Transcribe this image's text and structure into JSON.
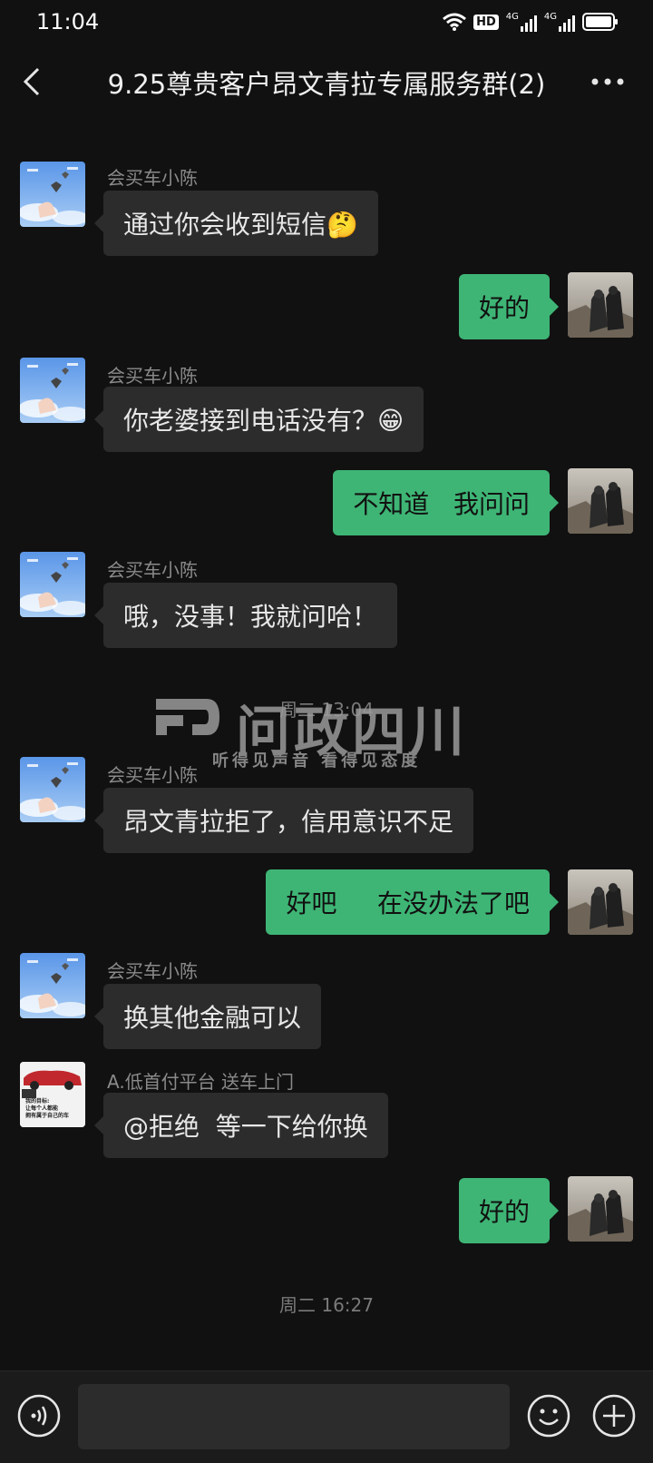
{
  "status_bar": {
    "time": "11:04",
    "icons": [
      "wifi-icon",
      "hd-icon",
      "signal-4g-icon",
      "signal-4g-icon",
      "battery-icon"
    ],
    "hd_label": "HD",
    "net_label_1": "4G",
    "net_label_2": "4G"
  },
  "nav": {
    "title": "9.25尊贵客户昂文青拉专属服务群(2)"
  },
  "messages": [
    {
      "side": "in",
      "sender": "会买车小陈",
      "text": "通过你会收到短信🤔"
    },
    {
      "side": "out",
      "text": "好的"
    },
    {
      "side": "in",
      "sender": "会买车小陈",
      "text": "你老婆接到电话没有？😁"
    },
    {
      "side": "out",
      "text": "不知道   我问问"
    },
    {
      "side": "in",
      "sender": "会买车小陈",
      "text": "哦，没事！我就问哈！"
    },
    {
      "side": "in",
      "sender": "会买车小陈",
      "text": "昂文青拉拒了，信用意识不足"
    },
    {
      "side": "out",
      "text": "好吧     在没办法了吧"
    },
    {
      "side": "in",
      "sender": "会买车小陈",
      "text": "换其他金融可以"
    },
    {
      "side": "in",
      "sender": "A.低首付平台 送车上门",
      "text": "@拒绝  等一下给你换"
    },
    {
      "side": "out",
      "text": "好的"
    }
  ],
  "timestamps": [
    "周二 13:04",
    "周二 16:27"
  ],
  "watermark": {
    "title": "问政四川",
    "subtitle": "听得见声音  看得见态度"
  },
  "avatar_text": {
    "car_line1": "我的目标:",
    "car_line2": "让每个人都能",
    "car_line3": "拥有属于自己的车"
  },
  "input_bar": {
    "icons": [
      "voice-icon",
      "emoji-icon",
      "plus-icon"
    ]
  },
  "colors": {
    "background": "#111111",
    "incoming_bubble": "#2c2c2c",
    "outgoing_bubble": "#3eb575"
  }
}
